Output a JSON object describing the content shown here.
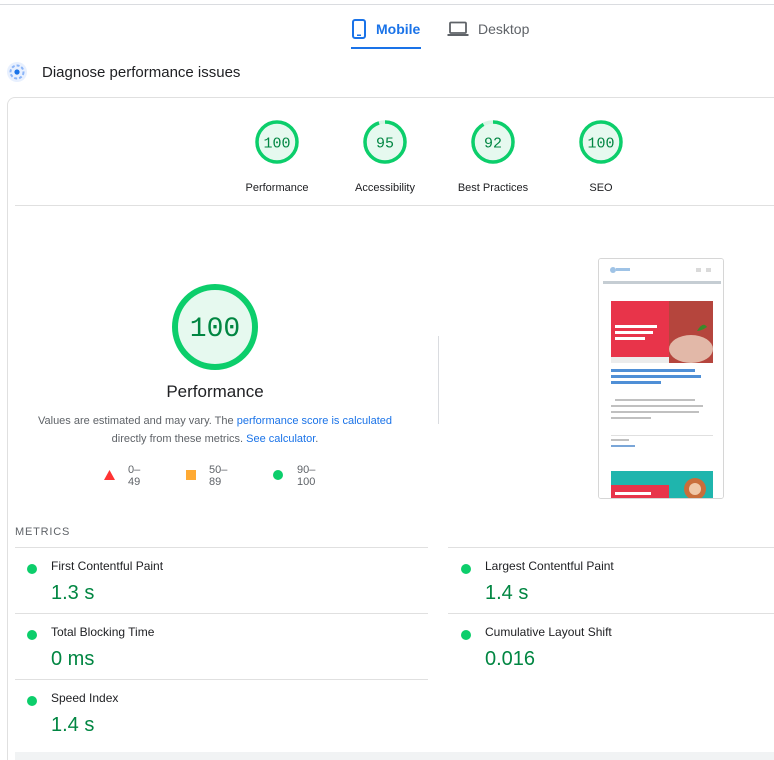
{
  "tabs": [
    {
      "label": "Mobile",
      "icon": "smartphone-icon",
      "active": true
    },
    {
      "label": "Desktop",
      "icon": "laptop-icon",
      "active": false
    }
  ],
  "diagnose": {
    "title": "Diagnose performance issues"
  },
  "categories": [
    {
      "score": "100",
      "label": "Performance"
    },
    {
      "score": "95",
      "label": "Accessibility"
    },
    {
      "score": "92",
      "label": "Best Practices"
    },
    {
      "score": "100",
      "label": "SEO"
    }
  ],
  "main_gauge": {
    "score": "100",
    "title": "Performance"
  },
  "description": {
    "part1": "Values are estimated and may vary. The ",
    "link1": "performance score is calculated",
    "part2": " directly from these metrics. ",
    "link2": "See calculator",
    "part3": "."
  },
  "legend": [
    {
      "range": "0–49",
      "color": "#ff3333",
      "shape": "triangle"
    },
    {
      "range": "50–89",
      "color": "#ffaa33",
      "shape": "square"
    },
    {
      "range": "90–100",
      "color": "#0cce6b",
      "shape": "circle"
    }
  ],
  "metrics_header": "METRICS",
  "metrics": [
    {
      "name": "First Contentful Paint",
      "value": "1.3 s"
    },
    {
      "name": "Largest Contentful Paint",
      "value": "1.4 s"
    },
    {
      "name": "Total Blocking Time",
      "value": "0 ms"
    },
    {
      "name": "Cumulative Layout Shift",
      "value": "0.016"
    },
    {
      "name": "Speed Index",
      "value": "1.4 s"
    }
  ],
  "colors": {
    "pass": "#0cce6b",
    "pass_text": "#018642",
    "pass_bg": "#e6f9ef",
    "accent": "#1a73e8"
  }
}
